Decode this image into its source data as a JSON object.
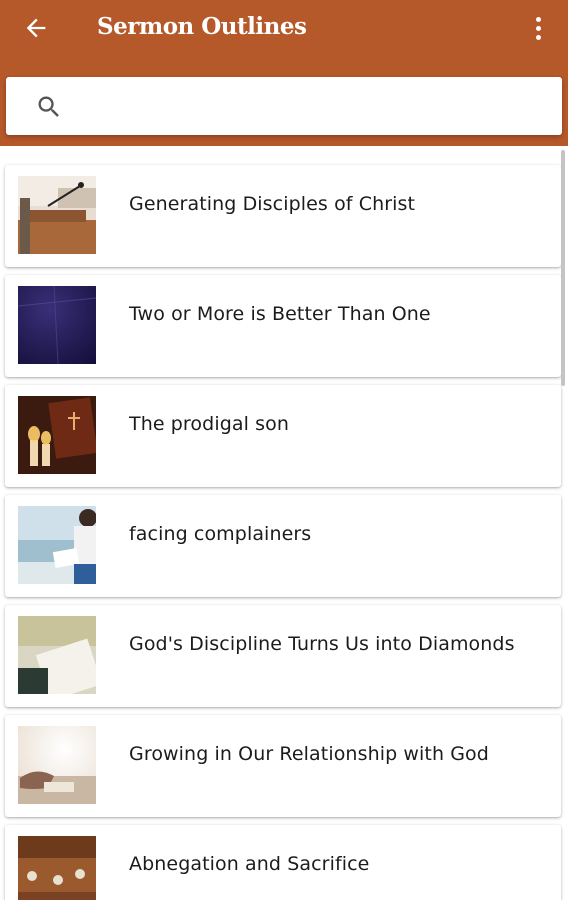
{
  "appbar": {
    "title": "Sermon Outlines",
    "back_icon": "arrow-back-icon",
    "more_icon": "more-vert-icon",
    "color": "#b5582a"
  },
  "search": {
    "value": "",
    "placeholder": "",
    "icon": "search-icon"
  },
  "list": {
    "items": [
      {
        "title": "Generating Disciples of Christ",
        "thumb": "pulpit-microphone"
      },
      {
        "title": "Two or More is Better Than One",
        "thumb": "dark-blue-night"
      },
      {
        "title": "The prodigal son",
        "thumb": "bible-candles"
      },
      {
        "title": "facing complainers",
        "thumb": "person-reading-by-sea"
      },
      {
        "title": "God's Discipline Turns Us into Diamonds",
        "thumb": "bible-paper"
      },
      {
        "title": "Growing in Our Relationship with God",
        "thumb": "hands-light"
      },
      {
        "title": "Abnegation and Sacrifice",
        "thumb": "sacrifice-objects"
      }
    ]
  }
}
